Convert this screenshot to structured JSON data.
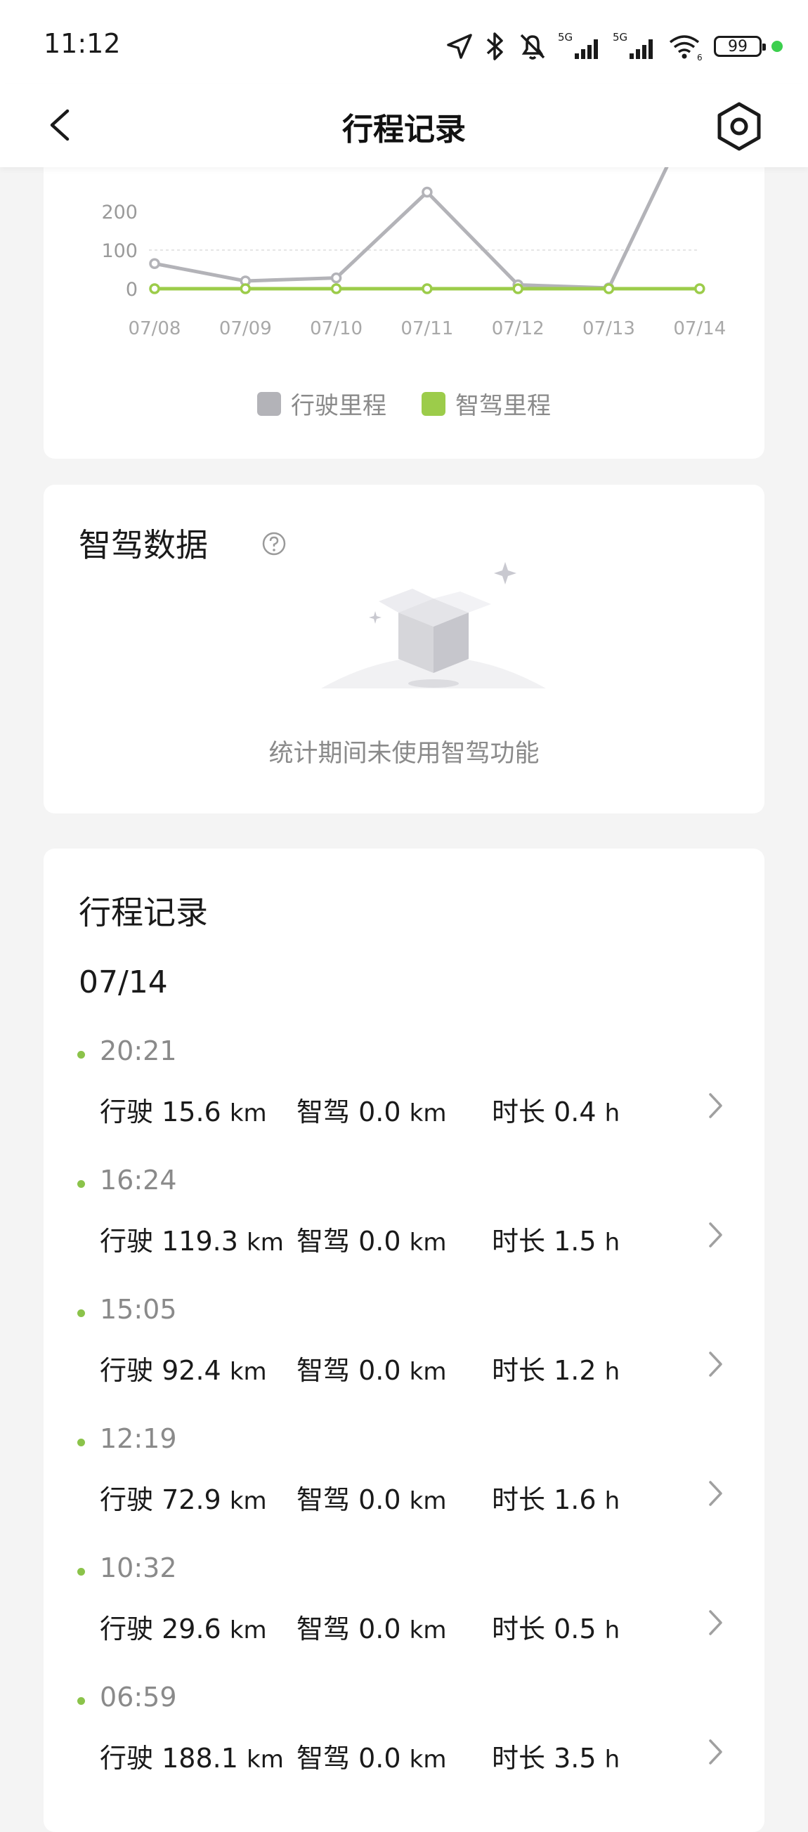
{
  "status_bar": {
    "time": "11:12",
    "battery": "99",
    "network_labels": [
      "5G",
      "5G"
    ],
    "wifi_label": "6"
  },
  "nav": {
    "title": "行程记录",
    "back_icon": "back-arrow-icon",
    "settings_icon": "hexagon-settings-icon"
  },
  "chart_data": {
    "type": "line",
    "categories": [
      "07/08",
      "07/09",
      "07/10",
      "07/11",
      "07/12",
      "07/13",
      "07/14"
    ],
    "yticks": [
      "0",
      "100",
      "200"
    ],
    "ylim": [
      0,
      200
    ],
    "series": [
      {
        "name": "行驶里程",
        "color": "#b3b3b8",
        "values": [
          65,
          20,
          28,
          250,
          10,
          2,
          530
        ]
      },
      {
        "name": "智驾里程",
        "color": "#9ccc4a",
        "values": [
          0,
          0,
          0,
          0,
          0,
          0,
          0
        ]
      }
    ],
    "legend": [
      "行驶里程",
      "智驾里程"
    ]
  },
  "zhijia": {
    "title": "智驾数据",
    "empty_text": "统计期间未使用智驾功能"
  },
  "trips": {
    "title": "行程记录",
    "date": "07/14",
    "label_drive": "行驶",
    "label_zhijia": "智驾",
    "label_duration": "时长",
    "items": [
      {
        "time": "20:21",
        "drive": "15.6",
        "drive_unit": "km",
        "zhijia": "0.0",
        "zhijia_unit": "km",
        "duration": "0.4",
        "duration_unit": "h"
      },
      {
        "time": "16:24",
        "drive": "119.3",
        "drive_unit": "km",
        "zhijia": "0.0",
        "zhijia_unit": "km",
        "duration": "1.5",
        "duration_unit": "h"
      },
      {
        "time": "15:05",
        "drive": "92.4",
        "drive_unit": "km",
        "zhijia": "0.0",
        "zhijia_unit": "km",
        "duration": "1.2",
        "duration_unit": "h"
      },
      {
        "time": "12:19",
        "drive": "72.9",
        "drive_unit": "km",
        "zhijia": "0.0",
        "zhijia_unit": "km",
        "duration": "1.6",
        "duration_unit": "h"
      },
      {
        "time": "10:32",
        "drive": "29.6",
        "drive_unit": "km",
        "zhijia": "0.0",
        "zhijia_unit": "km",
        "duration": "0.5",
        "duration_unit": "h"
      },
      {
        "time": "06:59",
        "drive": "188.1",
        "drive_unit": "km",
        "zhijia": "0.0",
        "zhijia_unit": "km",
        "duration": "3.5",
        "duration_unit": "h"
      }
    ]
  }
}
